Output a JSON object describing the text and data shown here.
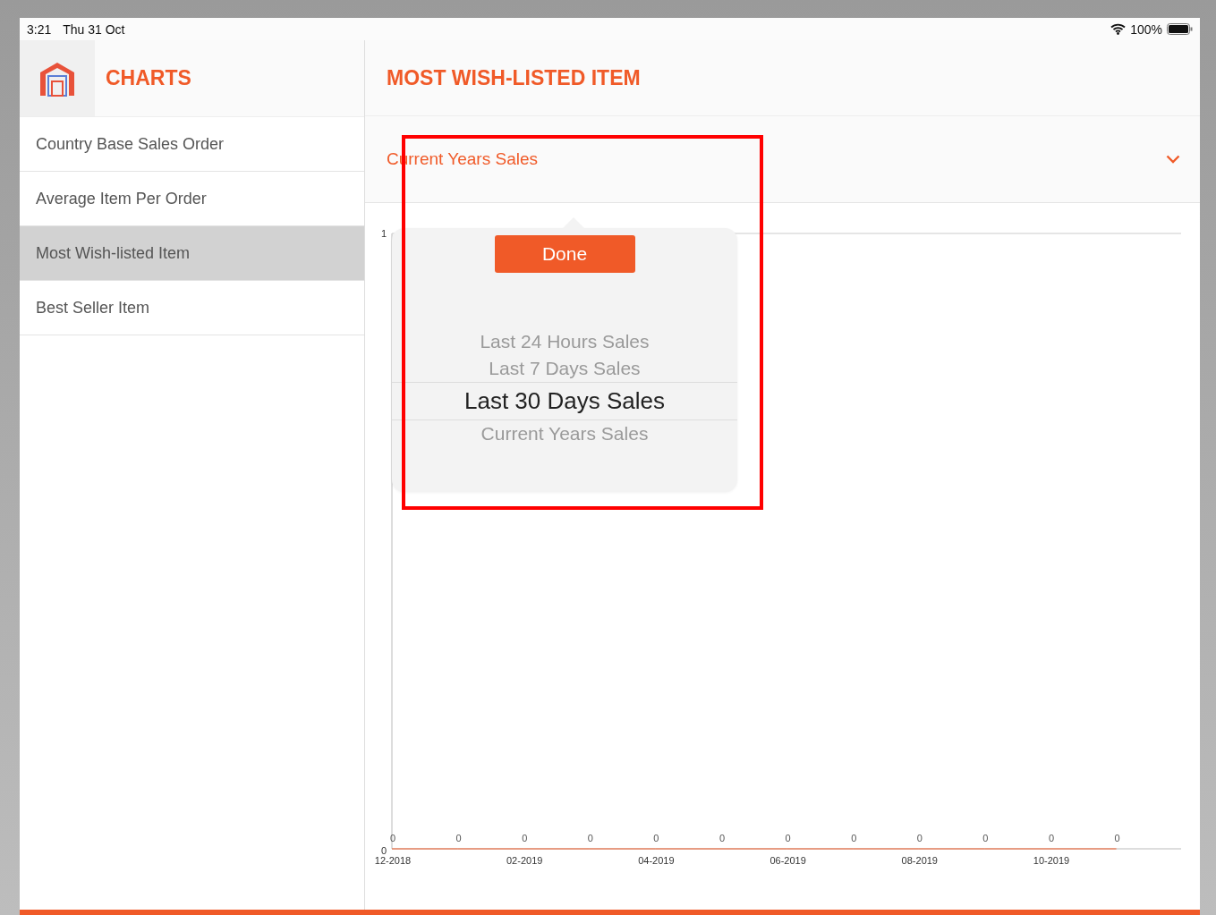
{
  "status_bar": {
    "time": "3:21",
    "date": "Thu 31 Oct",
    "battery": "100%"
  },
  "sidebar": {
    "title": "CHARTS",
    "items": [
      {
        "label": "Country Base Sales Order",
        "selected": false
      },
      {
        "label": "Average Item Per Order",
        "selected": false
      },
      {
        "label": "Most Wish-listed Item",
        "selected": true
      },
      {
        "label": "Best Seller Item",
        "selected": false
      }
    ]
  },
  "main": {
    "title": "MOST WISH-LISTED ITEM",
    "dropdown": {
      "value": "Current Years Sales"
    },
    "picker": {
      "done": "Done",
      "options": [
        {
          "label": "Last 24 Hours Sales",
          "selected": false
        },
        {
          "label": "Last 7 Days Sales",
          "selected": false
        },
        {
          "label": "Last 30 Days Sales",
          "selected": true
        },
        {
          "label": "Current Years Sales",
          "selected": false
        }
      ]
    },
    "chart_data": {
      "type": "line",
      "categories": [
        "12-2018",
        null,
        "02-2019",
        null,
        "04-2019",
        null,
        "06-2019",
        null,
        "08-2019",
        null,
        "10-2019",
        null
      ],
      "series": [
        {
          "color": "#f05a28",
          "values": [
            0,
            0,
            0,
            0,
            0,
            0,
            0,
            0,
            0,
            0,
            0,
            0
          ]
        }
      ],
      "ylim": [
        0,
        1
      ],
      "yticks": [
        0,
        1
      ],
      "data_labels": true
    }
  },
  "annotation": {
    "shown": true
  }
}
